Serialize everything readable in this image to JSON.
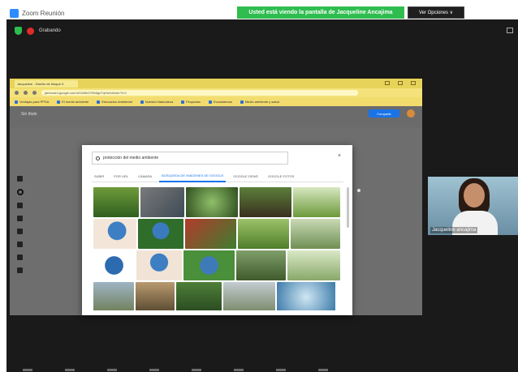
{
  "zoom": {
    "window_title": "Zoom Reunión",
    "share_banner": "Usted está viendo la pantalla de Jacqueline Ancajima",
    "view_options": "Ver Opciones ∨",
    "recording_label": "Grabando"
  },
  "browser": {
    "tab_title": "Jacqueline - Diseño de bloque X",
    "url": "jamboard.google.com/d/1W8n0Y5b6gsTqHm/viewer?f=0",
    "bookmarks": [
      "Ventajas para PPSA",
      "El medio ambiente",
      "Educación Ambiental",
      "Nuestra Naturaleza",
      "Proyectos",
      "Ecosistemas",
      "Medio ambiente y salud"
    ],
    "site_title": "Sin título",
    "share_button": "Compartir"
  },
  "image_search": {
    "query": "protección del medio ambiente",
    "tabs": [
      {
        "label": "SUBIR",
        "active": false
      },
      {
        "label": "POR URL",
        "active": false
      },
      {
        "label": "CÁMARA",
        "active": false
      },
      {
        "label": "BÚSQUEDA DE IMÁGENES DE GOOGLE",
        "active": true
      },
      {
        "label": "GOOGLE DRIVE",
        "active": false
      },
      {
        "label": "GOOGLE FOTOS",
        "active": false
      }
    ],
    "accent_color": "#1a73e8"
  },
  "participant": {
    "name": "Jacqueline ancajima"
  }
}
